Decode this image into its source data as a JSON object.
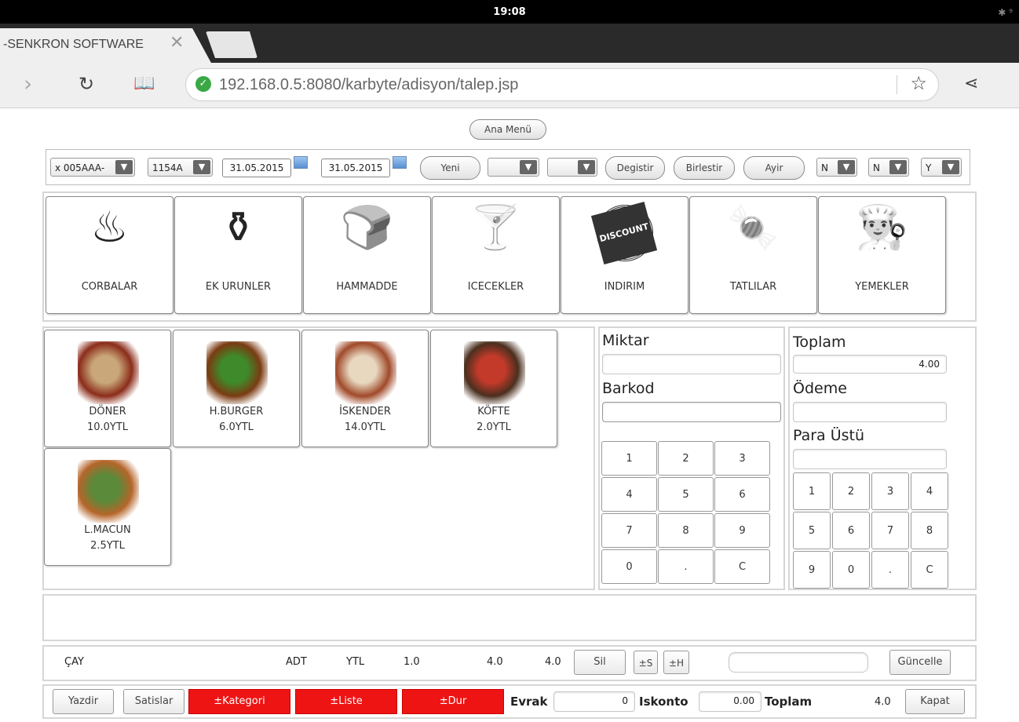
{
  "status_bar": {
    "time": "19:08",
    "bluetooth": "✱ ⁹"
  },
  "browser": {
    "tab_title": "-SENKRON SOFTWARE",
    "url": "192.168.0.5:8080/karbyte/adisyon/talep.jsp"
  },
  "toolbar": {
    "ana_menu": "Ana Menü",
    "table_select": "x 005AAA-",
    "code_select": "1154A",
    "date_from": "31.05.2015",
    "date_to": "31.05.2015",
    "yeni": "Yeni",
    "degistir": "Degistir",
    "birlestir": "Birlestir",
    "ayir": "Ayir",
    "flag1": "N",
    "flag2": "N",
    "flag3": "Y"
  },
  "categories": [
    {
      "label": "CORBALAR",
      "icon": "soup-pot-icon",
      "glyph": "♨"
    },
    {
      "label": "EK URUNLER",
      "icon": "salt-shakers-icon",
      "glyph": "⚱"
    },
    {
      "label": "HAMMADDE",
      "icon": "bread-basket-icon",
      "glyph": "🍞"
    },
    {
      "label": "ICECEKLER",
      "icon": "drinks-icon",
      "glyph": "🍸"
    },
    {
      "label": "INDIRIM",
      "icon": "discount-stamp-icon",
      "glyph": "DISCOUNT"
    },
    {
      "label": "TATLILAR",
      "icon": "candies-icon",
      "glyph": "🍬"
    },
    {
      "label": "YEMEKLER",
      "icon": "chef-icon",
      "glyph": "👨‍🍳"
    }
  ],
  "products": [
    {
      "name": "DÖNER",
      "price": "10.0YTL",
      "color1": "#8b2d1a",
      "color2": "#c9a77a"
    },
    {
      "name": "H.BURGER",
      "price": "6.0YTL",
      "color1": "#7a3b12",
      "color2": "#3f8a2a"
    },
    {
      "name": "İSKENDER",
      "price": "14.0YTL",
      "color1": "#a04a2a",
      "color2": "#e8d8c0"
    },
    {
      "name": "KÖFTE",
      "price": "2.0YTL",
      "color1": "#4a2f1e",
      "color2": "#c43a2a"
    },
    {
      "name": "L.MACUN",
      "price": "2.5YTL",
      "color1": "#b5652a",
      "color2": "#5a8a3a"
    }
  ],
  "entry": {
    "miktar_label": "Miktar",
    "barkod_label": "Barkod",
    "keys": [
      "1",
      "2",
      "3",
      "4",
      "5",
      "6",
      "7",
      "8",
      "9",
      "0",
      ".",
      "C"
    ]
  },
  "payment": {
    "toplam_label": "Toplam",
    "toplam_value": "4.00",
    "odeme_label": "Ödeme",
    "para_ustu_label": "Para Üstü",
    "keys": [
      "1",
      "2",
      "3",
      "4",
      "5",
      "6",
      "7",
      "8",
      "9",
      "0",
      ".",
      "C"
    ]
  },
  "order_row": {
    "item": "ÇAY",
    "unit": "ADT",
    "currency": "YTL",
    "qty": "1.0",
    "price": "4.0",
    "total": "4.0",
    "sil": "Sil",
    "plus_s": "±S",
    "plus_h": "±H",
    "guncelle": "Güncelle"
  },
  "footer": {
    "yazdir": "Yazdir",
    "satislar": "Satislar",
    "kategori": "±Kategori",
    "liste": "±Liste",
    "dur": "±Dur",
    "evrak_label": "Evrak",
    "evrak_value": "0",
    "iskonto_label": "Iskonto",
    "iskonto_value": "0.00",
    "toplam_label": "Toplam",
    "toplam_value": "4.0",
    "kapat": "Kapat"
  },
  "colors": {
    "accent_red": "#ee1414",
    "secure_green": "#3aa845"
  }
}
